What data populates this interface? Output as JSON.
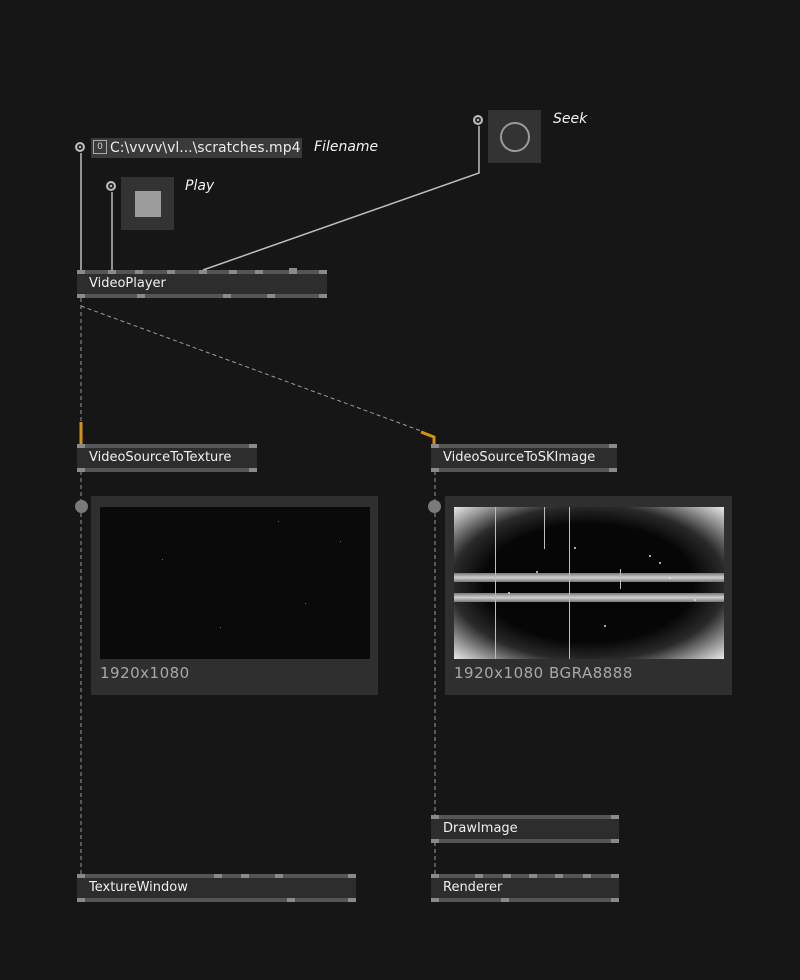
{
  "iobox": {
    "filename": {
      "index": "0",
      "value": "C:\\vvvv\\vl...\\scratches.mp4",
      "label": "Filename"
    },
    "play": {
      "label": "Play"
    },
    "seek": {
      "label": "Seek"
    }
  },
  "nodes": {
    "video_player": "VideoPlayer",
    "video_source_to_texture": "VideoSourceToTexture",
    "video_source_to_skimage": "VideoSourceToSKImage",
    "draw_image": "DrawImage",
    "texture_window": "TextureWindow",
    "renderer": "Renderer"
  },
  "previews": {
    "texture": {
      "caption": "1920x1080"
    },
    "skimage": {
      "caption": "1920x1080 BGRA8888"
    }
  },
  "colors": {
    "background": "#161616",
    "node": "#2d2d2d",
    "wire": "#bdbdbd",
    "link_highlight": "#d4920f"
  },
  "icons": {
    "iobox_pin": "circle-dot-icon",
    "seek": "circle-outline-icon",
    "play": "square-toggle-icon"
  }
}
